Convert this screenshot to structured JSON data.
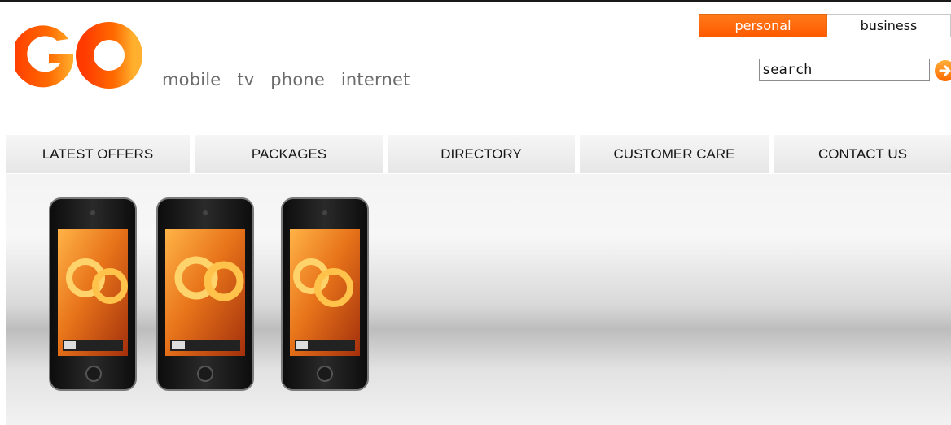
{
  "brand": {
    "logo_text": "GO",
    "services": [
      "mobile",
      "tv",
      "phone",
      "internet"
    ]
  },
  "segment_toggle": {
    "personal_label": "personal",
    "business_label": "business",
    "active": "personal"
  },
  "search": {
    "value": "search",
    "go_icon": "arrow-right-circle-icon"
  },
  "nav": {
    "items": [
      {
        "label": "LATEST OFFERS"
      },
      {
        "label": "PACKAGES"
      },
      {
        "label": "DIRECTORY"
      },
      {
        "label": "CUSTOMER CARE"
      },
      {
        "label": "CONTACT US"
      }
    ]
  },
  "colors": {
    "accent": "#ff6a00",
    "accent_light": "#ffae3a",
    "nav_bg": "#eeeeee",
    "service_text": "#6b6b6b"
  }
}
